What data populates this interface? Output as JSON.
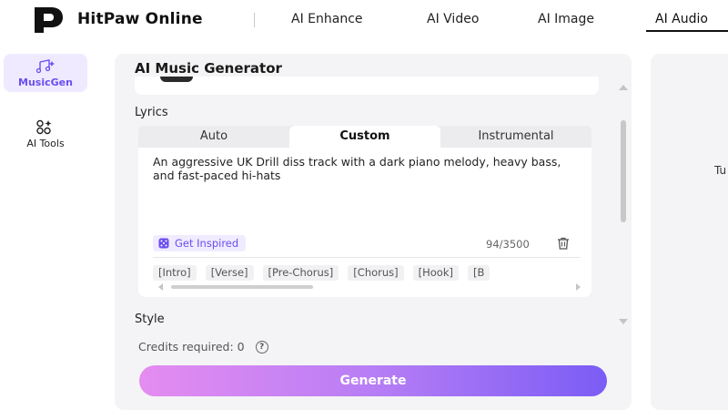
{
  "brand": {
    "name": "HitPaw Online"
  },
  "nav": {
    "items": [
      {
        "label": "AI Enhance"
      },
      {
        "label": "AI Video"
      },
      {
        "label": "AI Image"
      },
      {
        "label": "AI Audio",
        "active": true
      }
    ]
  },
  "sidebar": {
    "items": [
      {
        "label": "MusicGen",
        "icon": "music-note-icon",
        "active": true
      },
      {
        "label": "AI Tools",
        "icon": "tools-grid-icon"
      }
    ]
  },
  "panel": {
    "title": "AI Music Generator",
    "lyrics_label": "Lyrics",
    "tabs": [
      {
        "label": "Auto"
      },
      {
        "label": "Custom",
        "active": true
      },
      {
        "label": "Instrumental"
      }
    ],
    "lyrics_text": "An aggressive UK Drill diss track with a dark piano melody, heavy bass, and fast-paced hi-hats",
    "inspire_label": "Get Inspired",
    "char_count": "94/3500",
    "chips": [
      "[Intro]",
      "[Verse]",
      "[Pre-Chorus]",
      "[Chorus]",
      "[Hook]",
      "[B"
    ],
    "style_label": "Style",
    "credits_text": "Credits required: 0",
    "generate_label": "Generate"
  },
  "right_panel": {
    "text": "Tu"
  },
  "colors": {
    "accent": "#6b4ef0",
    "gradient_start": "#e58cf0",
    "gradient_end": "#7b5cf5"
  }
}
